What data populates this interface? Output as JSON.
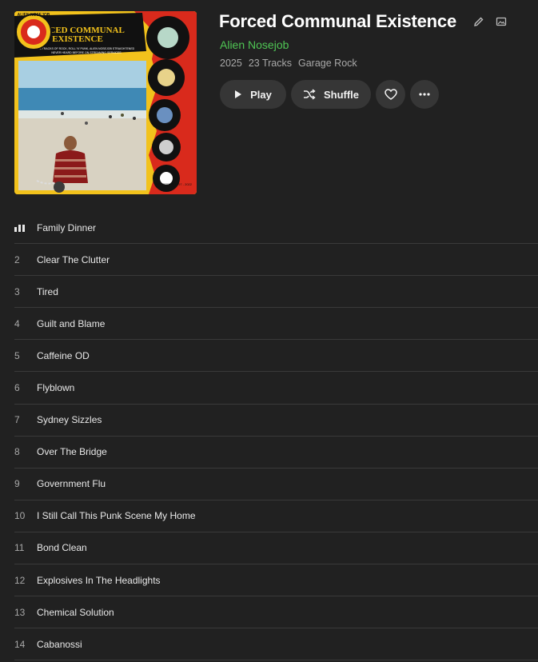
{
  "album": {
    "title": "Forced Communal Existence",
    "artist": "Alien Nosejob",
    "year": "2025",
    "track_count": "23 Tracks",
    "genre": "Garage Rock"
  },
  "cover": {
    "title_line1": "FORCED COMMUNAL",
    "title_line2": "EXISTENCE",
    "tagline1": "23 TRACKS OF ROCK, ROLL 'N' PUNK, ALIEN NOSEJOB STRAIGHTENED",
    "tagline2": "NEVER HEARD BEFORE ON STREAMING SERVICES",
    "badge": "ALIEN NOSEJOB",
    "corner_text": "RECORDED 1997 - 2022"
  },
  "actions": {
    "play_label": "Play",
    "shuffle_label": "Shuffle"
  },
  "colors": {
    "background": "#212121",
    "accent_green": "#4fc654",
    "button_bg": "#363636",
    "cover_yellow": "#f2c21c",
    "cover_red": "#d92a1c"
  },
  "icons": {
    "edit": "pencil-icon",
    "image": "image-icon",
    "play": "play-icon",
    "shuffle": "shuffle-icon",
    "like": "heart-icon",
    "more": "more-icon",
    "now_playing": "equalizer-icon"
  },
  "tracks": [
    {
      "number": "",
      "title": "Family Dinner",
      "playing": true
    },
    {
      "number": "2",
      "title": "Clear The Clutter"
    },
    {
      "number": "3",
      "title": "Tired"
    },
    {
      "number": "4",
      "title": "Guilt and Blame"
    },
    {
      "number": "5",
      "title": "Caffeine OD"
    },
    {
      "number": "6",
      "title": "Flyblown"
    },
    {
      "number": "7",
      "title": "Sydney Sizzles"
    },
    {
      "number": "8",
      "title": "Over The Bridge"
    },
    {
      "number": "9",
      "title": "Government Flu"
    },
    {
      "number": "10",
      "title": "I Still Call This Punk Scene My Home"
    },
    {
      "number": "11",
      "title": "Bond Clean"
    },
    {
      "number": "12",
      "title": "Explosives In The Headlights"
    },
    {
      "number": "13",
      "title": "Chemical Solution"
    },
    {
      "number": "14",
      "title": "Cabanossi"
    }
  ]
}
